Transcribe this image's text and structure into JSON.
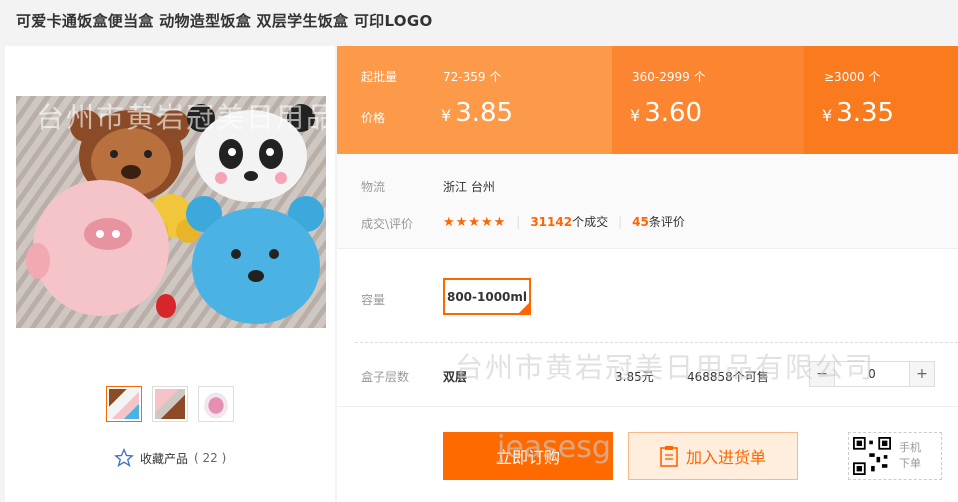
{
  "product": {
    "title": "可爱卡通饭盒便当盒 动物造型饭盒 双层学生饭盒 可印LOGO"
  },
  "pricing": {
    "qty_label": "起批量",
    "price_label": "价格",
    "currency": "¥",
    "tiers": [
      {
        "range": "72-359 个",
        "price": "3.85"
      },
      {
        "range": "360-2999 个",
        "price": "3.60"
      },
      {
        "range": "≥3000 个",
        "price": "3.35"
      }
    ]
  },
  "logistics": {
    "label": "物流",
    "value": "浙江 台州"
  },
  "deals": {
    "label": "成交\\评价",
    "stars": "★★★★★",
    "count": "31142",
    "count_suffix": "个成交",
    "reviews": "45",
    "reviews_suffix": "条评价"
  },
  "capacity": {
    "label": "容量",
    "option": "800-1000ml"
  },
  "layers": {
    "label": "盒子层数",
    "option": "双层",
    "price": "3.85元",
    "stock": "468858个可售",
    "qty": "0",
    "minus": "−",
    "plus": "+"
  },
  "actions": {
    "buy": "立即订购",
    "cart": "加入进货单",
    "qr_line1": "手机",
    "qr_line2": "下单"
  },
  "gallery": {
    "fav_label": "收藏产品",
    "fav_count": "( 22 )"
  },
  "watermarks": {
    "company": "台州市黄岩冠美日用品有限公司",
    "brand": "jeasesg"
  },
  "colors": {
    "accent": "#ff6a00"
  }
}
